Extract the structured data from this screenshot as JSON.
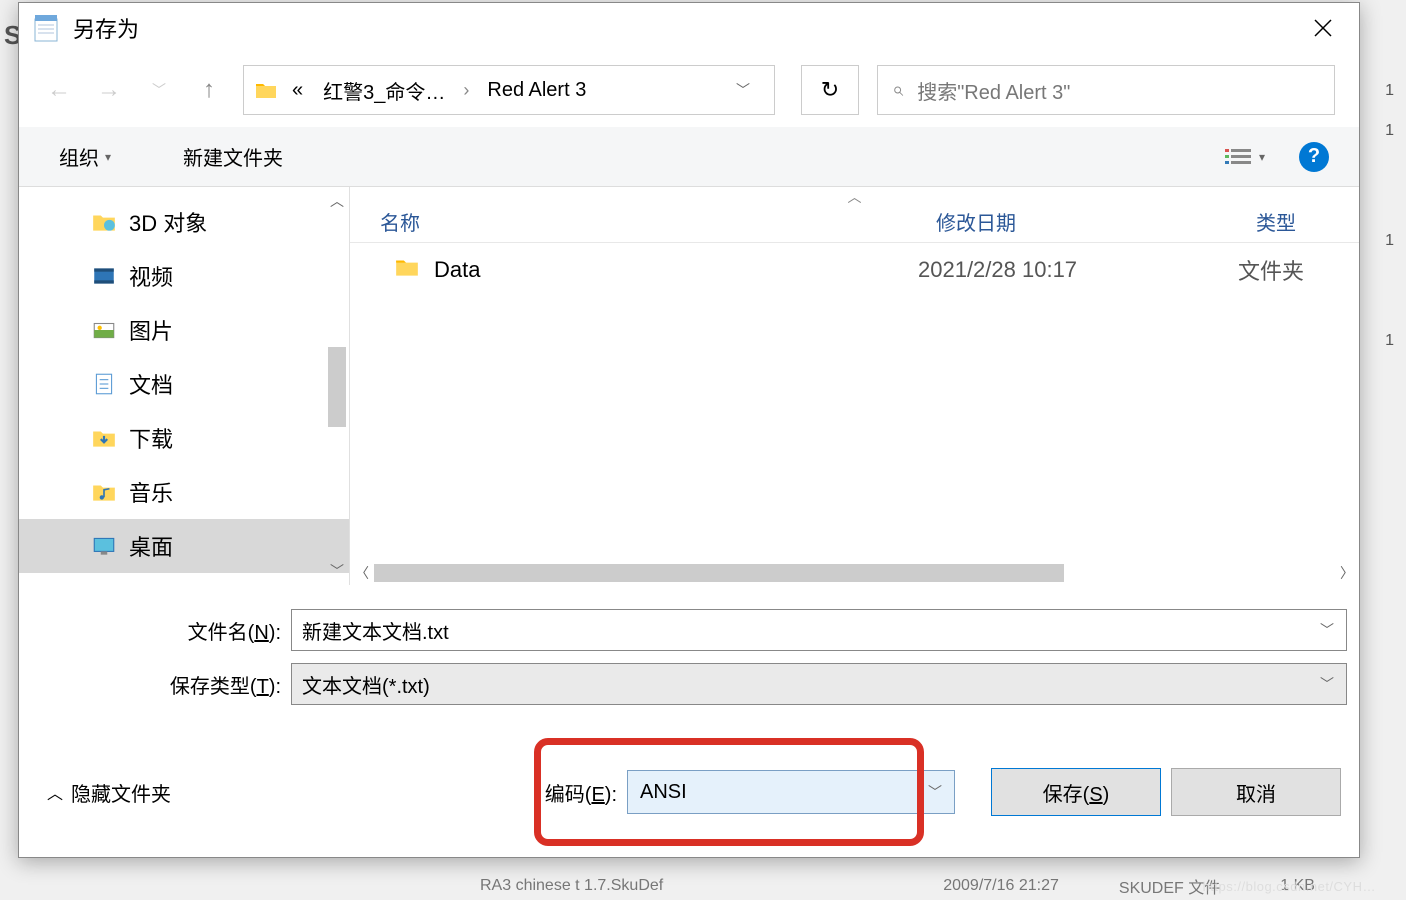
{
  "titlebar": {
    "title": "另存为"
  },
  "breadcrumb": {
    "prefix": "«",
    "part1": "红警3_命令…",
    "part2": "Red Alert 3"
  },
  "search": {
    "placeholder": "搜索\"Red Alert 3\""
  },
  "toolbar": {
    "organize": "组织",
    "new_folder": "新建文件夹"
  },
  "sidebar": {
    "items": [
      {
        "label": "3D 对象",
        "icon": "3d"
      },
      {
        "label": "视频",
        "icon": "video"
      },
      {
        "label": "图片",
        "icon": "images"
      },
      {
        "label": "文档",
        "icon": "docs"
      },
      {
        "label": "下载",
        "icon": "downloads"
      },
      {
        "label": "音乐",
        "icon": "music"
      },
      {
        "label": "桌面",
        "icon": "desktop"
      }
    ],
    "selected_index": 6
  },
  "file_list": {
    "columns": {
      "name": "名称",
      "date": "修改日期",
      "type": "类型"
    },
    "rows": [
      {
        "name": "Data",
        "date": "2021/2/28 10:17",
        "type": "文件夹"
      }
    ]
  },
  "fields": {
    "filename_label_pre": "文件名(",
    "filename_label_key": "N",
    "filename_label_post": "):",
    "filename_value": "新建文本文档.txt",
    "filetype_label_pre": "保存类型(",
    "filetype_label_key": "T",
    "filetype_label_post": "):",
    "filetype_value": "文本文档(*.txt)"
  },
  "bottom": {
    "hide_folders": "隐藏文件夹",
    "encoding_label_pre": "编码(",
    "encoding_label_key": "E",
    "encoding_label_post": "):",
    "encoding_value": "ANSI",
    "save_pre": "保存(",
    "save_key": "S",
    "save_post": ")",
    "cancel": "取消"
  },
  "background": {
    "file1": "RA3 chinese t 1.7.SkuDef",
    "file1_date": "2009/7/16 21:27",
    "file1_type": "SKUDEF 文件",
    "file1_size": "1 KB",
    "left_letter": "S"
  }
}
